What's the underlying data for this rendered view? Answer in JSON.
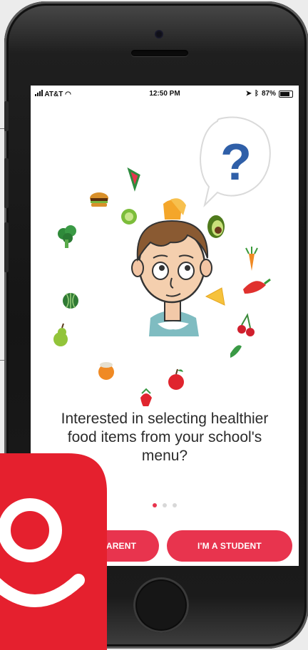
{
  "status_bar": {
    "carrier": "AT&T",
    "time": "12:50 PM",
    "battery": "87%"
  },
  "onboarding": {
    "headline_lines": [
      "Interested in selecting healthier",
      "food items from your school's",
      "menu?"
    ],
    "page_count": 3,
    "active_page": 1,
    "question_mark": "?"
  },
  "buttons": {
    "parent_label": "ARENT",
    "student_label": "I'M A STUDENT"
  },
  "colors": {
    "accent": "#e8344e",
    "logo": "#e5202e",
    "question": "#2f5fa8"
  },
  "icons": {
    "food": [
      "watermelon",
      "burger",
      "kiwi",
      "bread",
      "avocado",
      "broccoli",
      "carrot",
      "watermelon-round",
      "cheese",
      "chili-pepper",
      "cherry",
      "pear",
      "orange",
      "herb",
      "apple",
      "strawberry"
    ],
    "character": "boy-avatar",
    "bubble": "question-bubble"
  }
}
